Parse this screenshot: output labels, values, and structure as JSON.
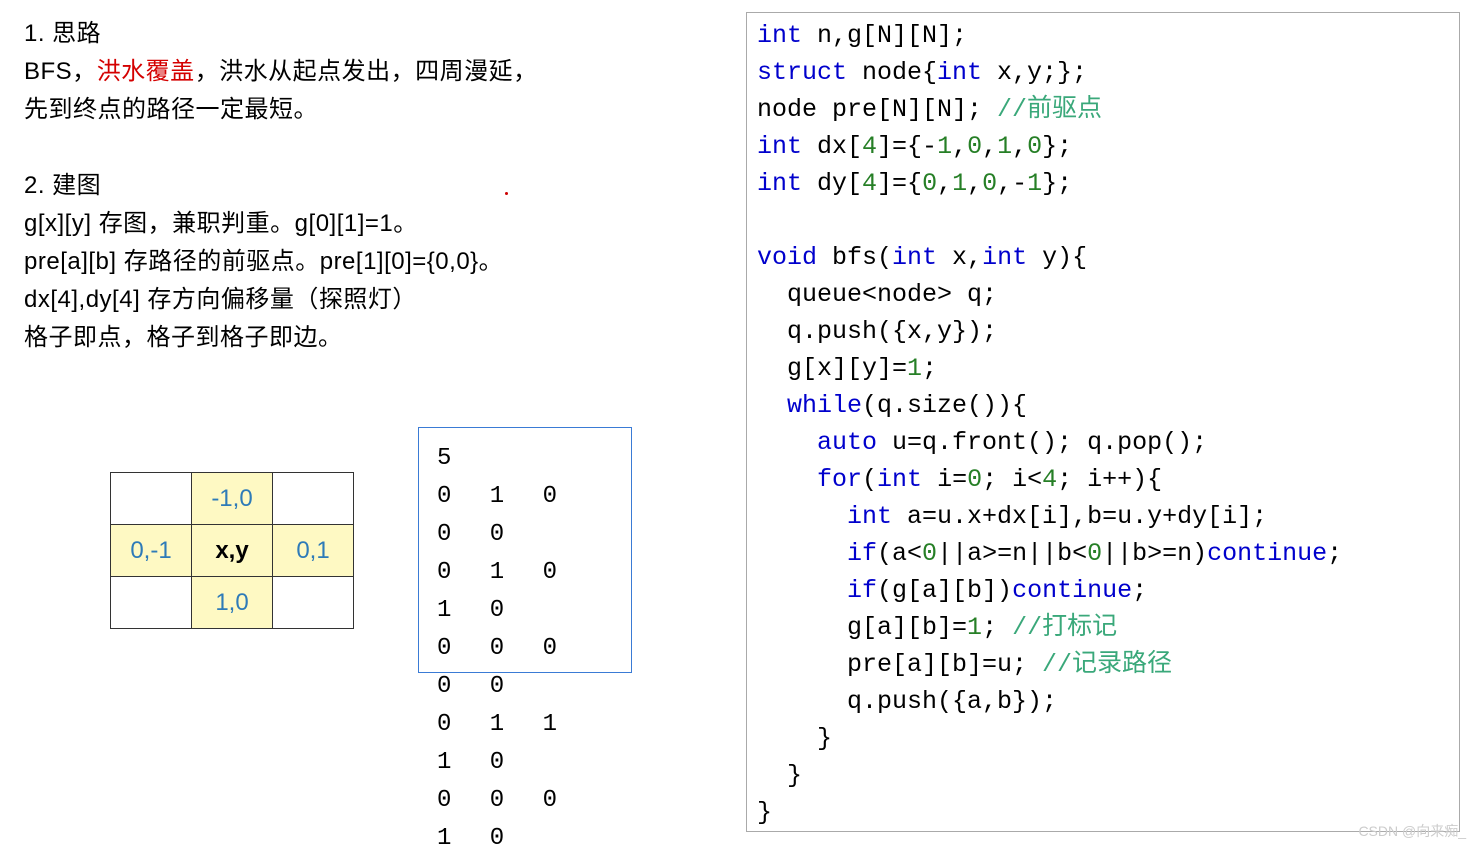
{
  "left": {
    "h1": "1. 思路",
    "p1a": "BFS，",
    "p1b": "洪水覆盖",
    "p1c": "，洪水从起点发出，四周漫延，",
    "p1d": "先到终点的路径一定最短。",
    "h2": "2. 建图",
    "p2a": "g[x][y] 存图，兼职判重。g[0][1]=1。",
    "p2b": "pre[a][b] 存路径的前驱点。pre[1][0]={0,0}。",
    "p2c": "dx[4],dy[4] 存方向偏移量（探照灯）",
    "p2d": "格子即点，格子到格子即边。"
  },
  "dir": {
    "up": "-1,0",
    "left": "0,-1",
    "center": "x,y",
    "right": "0,1",
    "down": "1,0"
  },
  "matrix": {
    "n": "5",
    "r0": "0 1 0 0 0",
    "r1": "0 1 0 1 0",
    "r2": "0 0 0 0 0",
    "r3": "0 1 1 1 0",
    "r4": "0 0 0 1 0"
  },
  "code": {
    "l1a": "int",
    "l1b": " n,g[N][N];",
    "l2a": "struct",
    "l2b": " node{",
    "l2c": "int",
    "l2d": " x,y;};",
    "l3a": "node pre[N][N]; ",
    "l3b": "//前驱点",
    "l4a": "int",
    "l4b": " dx[",
    "l4c": "4",
    "l4d": "]={-",
    "l4e": "1",
    "l4f": ",",
    "l4g": "0",
    "l4h": ",",
    "l4i": "1",
    "l4j": ",",
    "l4k": "0",
    "l4l": "};",
    "l5a": "int",
    "l5b": " dy[",
    "l5c": "4",
    "l5d": "]={",
    "l5e": "0",
    "l5f": ",",
    "l5g": "1",
    "l5h": ",",
    "l5i": "0",
    "l5j": ",-",
    "l5k": "1",
    "l5l": "};",
    "l6": "",
    "l7a": "void",
    "l7b": " bfs(",
    "l7c": "int",
    "l7d": " x,",
    "l7e": "int",
    "l7f": " y){",
    "l8": "  queue<node> q;",
    "l9": "  q.push({x,y});",
    "l10a": "  g[x][y]=",
    "l10b": "1",
    "l10c": ";",
    "l11a": "  ",
    "l11b": "while",
    "l11c": "(q.size()){",
    "l12a": "    ",
    "l12b": "auto",
    "l12c": " u=q.front(); q.pop();",
    "l13a": "    ",
    "l13b": "for",
    "l13c": "(",
    "l13d": "int",
    "l13e": " i=",
    "l13f": "0",
    "l13g": "; i<",
    "l13h": "4",
    "l13i": "; i++){",
    "l14a": "      ",
    "l14b": "int",
    "l14c": " a=u.x+dx[i],b=u.y+dy[i];",
    "l15a": "      ",
    "l15b": "if",
    "l15c": "(a<",
    "l15d": "0",
    "l15e": "||a>=n||b<",
    "l15f": "0",
    "l15g": "||b>=n)",
    "l15h": "continue",
    "l15i": ";",
    "l16a": "      ",
    "l16b": "if",
    "l16c": "(g[a][b])",
    "l16d": "continue",
    "l16e": ";",
    "l17a": "      g[a][b]=",
    "l17b": "1",
    "l17c": "; ",
    "l17d": "//打标记",
    "l18a": "      pre[a][b]=u; ",
    "l18b": "//记录路径",
    "l19": "      q.push({a,b});",
    "l20": "    }",
    "l21": "  }",
    "l22": "}"
  },
  "watermark": "CSDN @向来痴_"
}
